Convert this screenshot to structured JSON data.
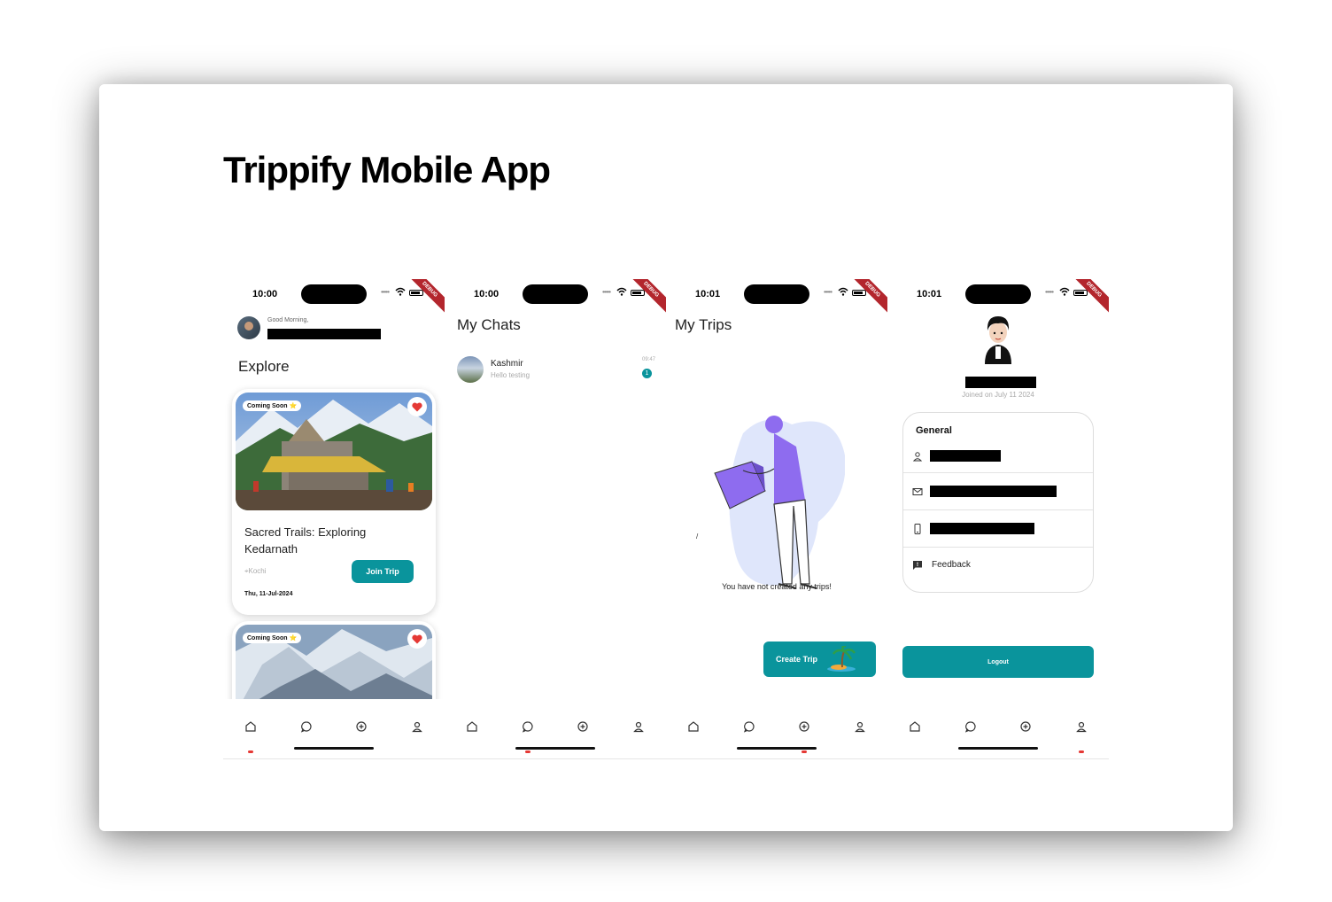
{
  "page": {
    "title": "Trippify Mobile App"
  },
  "colors": {
    "accent": "#0a949c",
    "debug_banner": "#b3262d",
    "heart": "#e53935",
    "illustration": "#8e6cef"
  },
  "debug_label": "DEBUG",
  "screens": [
    {
      "status_time": "10:00",
      "greeting": "Good Morning,",
      "section_title": "Explore",
      "trips": [
        {
          "badge": "Coming Soon ⭐",
          "title": "Sacred Trails: Exploring Kedarnath",
          "location": "Kochi",
          "join_label": "Join Trip",
          "date": "Thu, 11-Jul-2024"
        },
        {
          "badge": "Coming Soon ⭐"
        }
      ]
    },
    {
      "status_time": "10:00",
      "title": "My Chats",
      "chats": [
        {
          "name": "Kashmir",
          "message": "Hello testing",
          "time": "09:47",
          "unread": "1"
        }
      ]
    },
    {
      "status_time": "10:01",
      "title": "My Trips",
      "slash": "/",
      "empty_message": "You have not created any trips!",
      "create_label": "Create Trip"
    },
    {
      "status_time": "10:01",
      "joined": "Joined on July 11 2024",
      "general_title": "General",
      "rows": [
        {
          "icon": "person-icon"
        },
        {
          "icon": "mail-icon"
        },
        {
          "icon": "phone-icon"
        },
        {
          "icon": "feedback-icon",
          "label": "Feedback"
        }
      ],
      "logout_label": "Logout"
    }
  ],
  "bottom_nav": [
    "home-icon",
    "chat-icon",
    "add-trip-icon",
    "profile-icon"
  ]
}
